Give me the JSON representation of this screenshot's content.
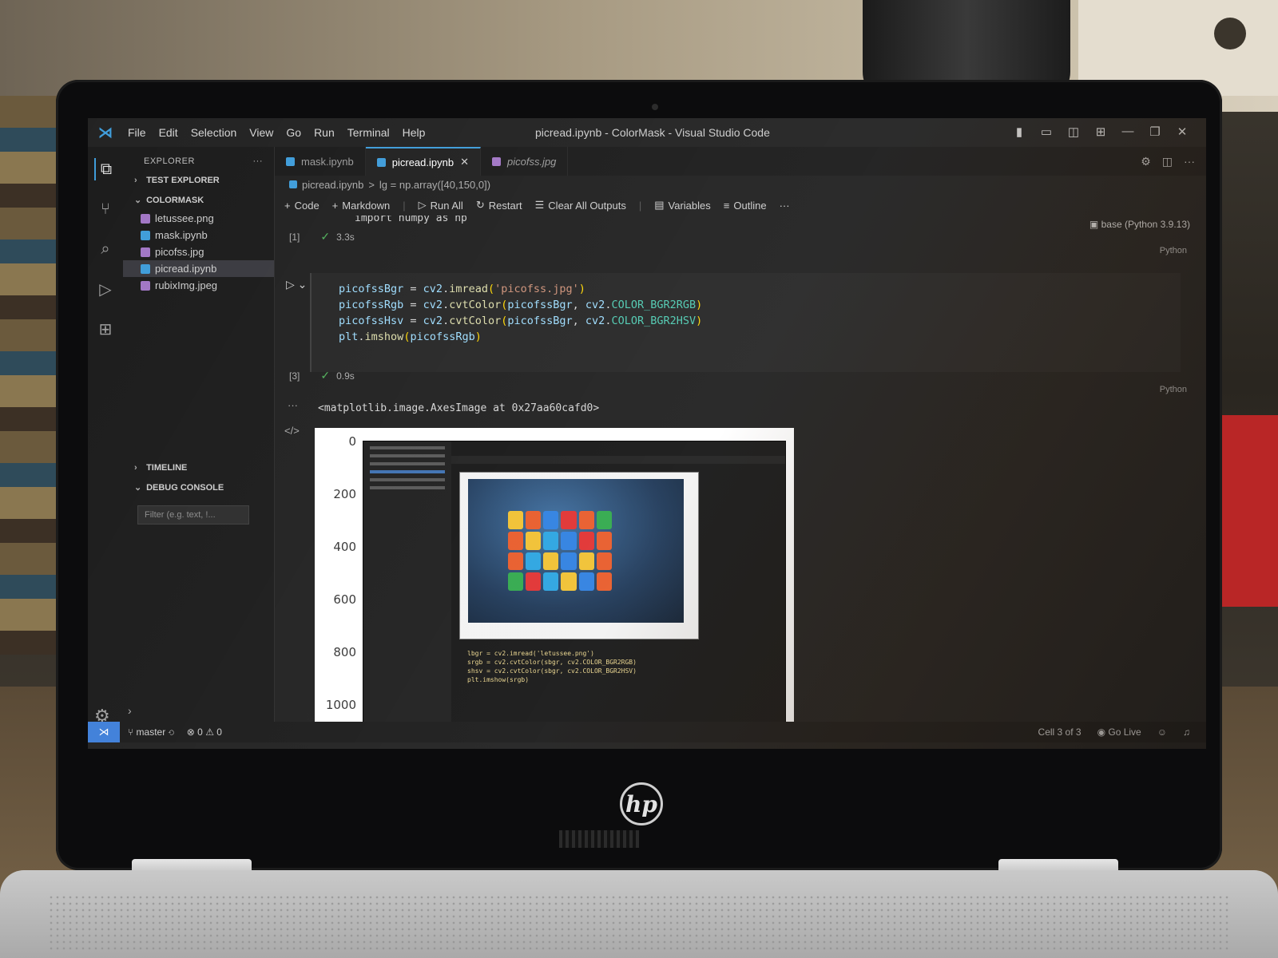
{
  "window": {
    "title": "picread.ipynb - ColorMask - Visual Studio Code",
    "controls": [
      "layout-toggle-1",
      "layout-toggle-2",
      "layout-toggle-3",
      "layout-toggle-4",
      "minimize",
      "restore",
      "close"
    ]
  },
  "menu": [
    "File",
    "Edit",
    "Selection",
    "View",
    "Go",
    "Run",
    "Terminal",
    "Help"
  ],
  "sidebar": {
    "header": "EXPLORER",
    "more": "···",
    "sections": {
      "test_explorer": "TEST EXPLORER",
      "colormask": "COLORMASK",
      "timeline": "TIMELINE",
      "debug_console": "DEBUG CONSOLE"
    },
    "files": [
      {
        "name": "letussee.png",
        "type": "image"
      },
      {
        "name": "mask.ipynb",
        "type": "notebook"
      },
      {
        "name": "picofss.jpg",
        "type": "image"
      },
      {
        "name": "picread.ipynb",
        "type": "notebook",
        "selected": true
      },
      {
        "name": "rubixImg.jpeg",
        "type": "image"
      }
    ],
    "filter_placeholder": "Filter (e.g. text, !..."
  },
  "tabs": [
    {
      "label": "mask.ipynb",
      "active": false
    },
    {
      "label": "picread.ipynb",
      "active": true,
      "close": "✕"
    },
    {
      "label": "picofss.jpg",
      "active": false,
      "italic": true
    }
  ],
  "breadcrumb": {
    "file": "picread.ipynb",
    "sep": ">",
    "symbol": "lg = np.array([40,150,0])"
  },
  "toolbar": {
    "code": "Code",
    "markdown": "Markdown",
    "run_all": "Run All",
    "restart": "Restart",
    "clear_outputs": "Clear All Outputs",
    "variables": "Variables",
    "outline": "Outline",
    "more": "···"
  },
  "kernel": "base (Python 3.9.13)",
  "cells": [
    {
      "index": "[1]",
      "duration": "3.3s",
      "language": "Python",
      "clipped_line": "import numpy as np"
    },
    {
      "index": "[3]",
      "duration": "0.9s",
      "language": "Python",
      "code_lines": [
        "picofssBgr = cv2.imread('picofss.jpg')",
        "picofssRgb = cv2.cvtColor(picofssBgr, cv2.COLOR_BGR2RGB)",
        "picofssHsv = cv2.cvtColor(picofssBgr, cv2.COLOR_BGR2HSV)",
        "plt.imshow(picofssRgb)"
      ],
      "output_text": "<matplotlib.image.AxesImage at 0x27aa60cafd0>"
    }
  ],
  "plot": {
    "y_ticks": [
      "0",
      "200",
      "400",
      "600",
      "800",
      "1000"
    ]
  },
  "status": {
    "branch": "master",
    "errors": "0",
    "warnings": "0",
    "cell": "Cell 3 of 3",
    "go_live": "Go Live"
  },
  "brand": "hp"
}
